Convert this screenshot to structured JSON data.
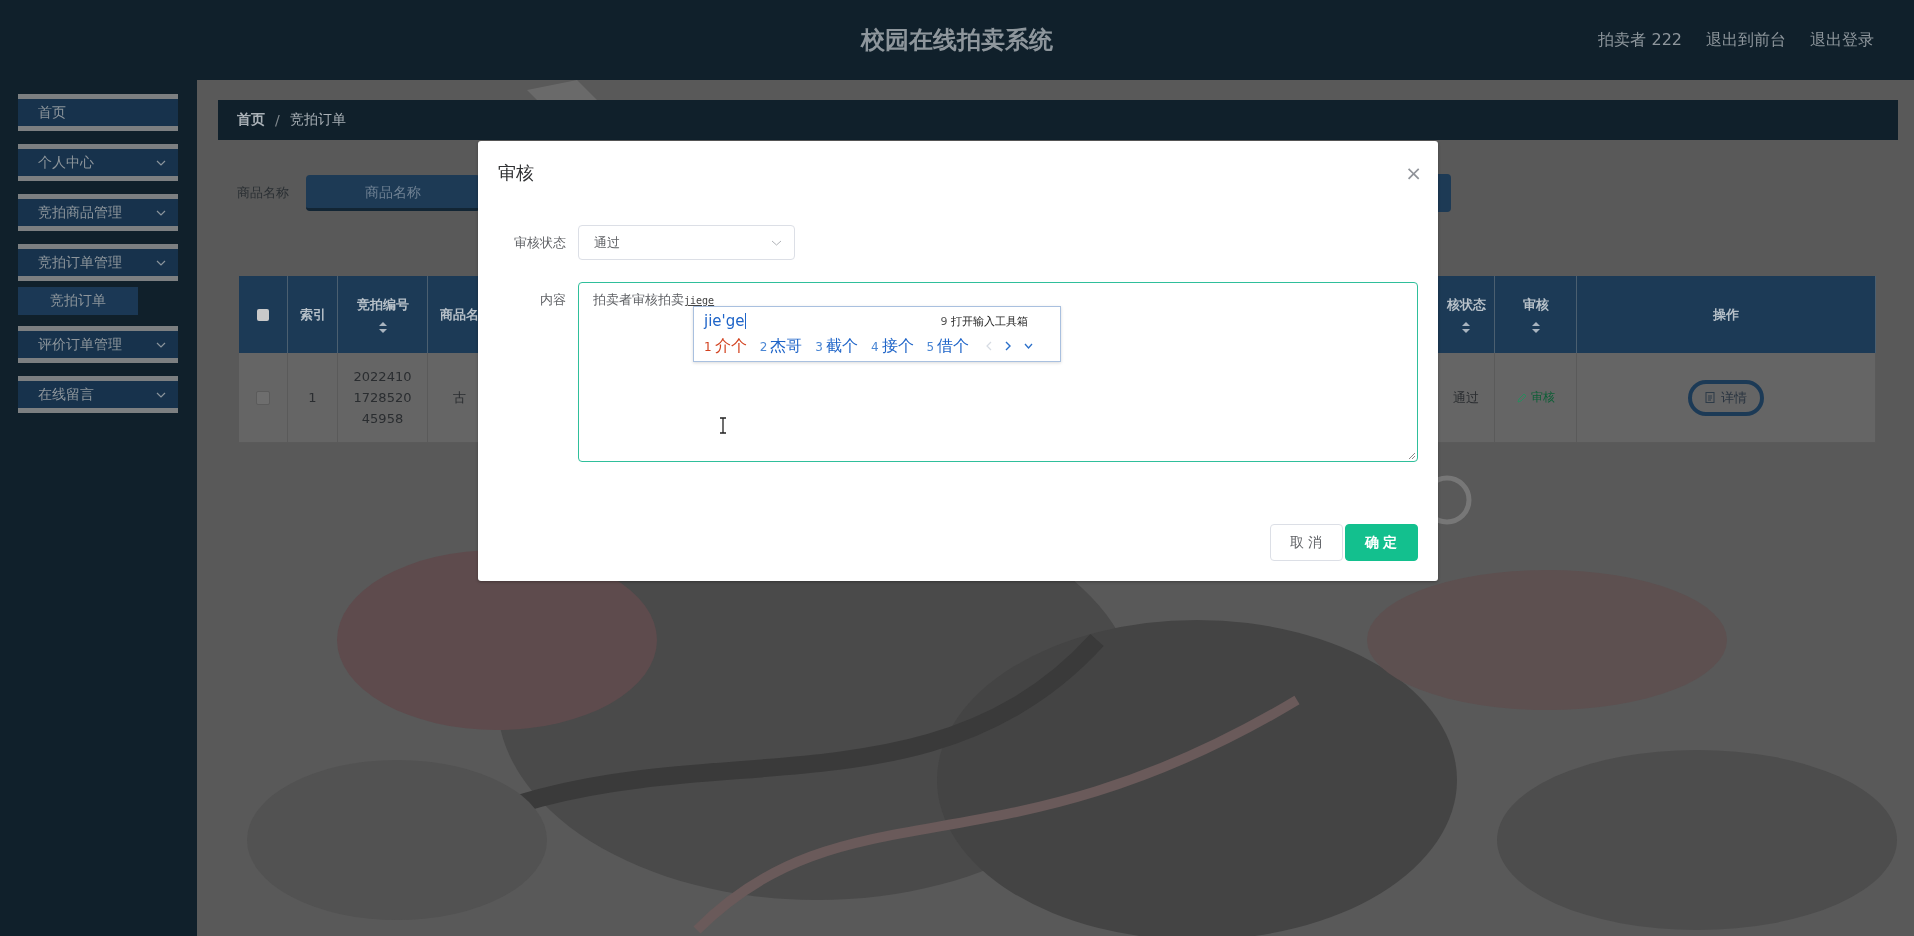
{
  "header": {
    "title": "校园在线拍卖系统",
    "user": "拍卖者 222",
    "links": [
      "退出到前台",
      "退出登录"
    ]
  },
  "sidebar": {
    "items": [
      {
        "label": "首页",
        "kind": "link",
        "selected": false
      },
      {
        "label": "个人中心",
        "kind": "submenu",
        "selected": false
      },
      {
        "label": "竞拍商品管理",
        "kind": "submenu",
        "selected": false
      },
      {
        "label": "竞拍订单管理",
        "kind": "submenu",
        "selected": false,
        "children": [
          {
            "label": "竞拍订单",
            "selected": true
          }
        ]
      },
      {
        "label": "评价订单管理",
        "kind": "submenu",
        "selected": false
      },
      {
        "label": "在线留言",
        "kind": "submenu",
        "selected": false
      }
    ]
  },
  "breadcrumb": {
    "items": [
      "首页",
      "竞拍订单"
    ],
    "separator": "/"
  },
  "search": {
    "label": "商品名称",
    "placeholder": "商品名称"
  },
  "table": {
    "header_checked": false,
    "columns": [
      {
        "label": "索引",
        "sortable": false
      },
      {
        "label": "竞拍编号",
        "sortable": true
      },
      {
        "label": "商品名",
        "sortable": false
      },
      {
        "label": "核状态",
        "sortable": true
      },
      {
        "label": "审核",
        "sortable": true
      },
      {
        "label": "操作",
        "sortable": false
      }
    ],
    "rows": [
      {
        "checked": false,
        "index": "1",
        "number": "2022410172852045958",
        "product": "古",
        "status": "通过",
        "review": "审核",
        "action": "详情"
      }
    ]
  },
  "dialog": {
    "title": "审核",
    "close": "×",
    "status_label": "审核状态",
    "status_value": "通过",
    "content_label": "内容",
    "content_value": "拍卖者审核拍卖",
    "composition": "jiege",
    "buttons": [
      {
        "label": "取消",
        "kind": "secondary"
      },
      {
        "label": "确定",
        "kind": "primary"
      }
    ]
  },
  "ime": {
    "input": "jie'ge",
    "tool_number": "9",
    "tool_label": "打开输入工具箱",
    "prev_disabled": true,
    "candidates": [
      {
        "number": "1",
        "text": "介个",
        "selected": true
      },
      {
        "number": "2",
        "text": "杰哥",
        "selected": false
      },
      {
        "number": "3",
        "text": "截个",
        "selected": false
      },
      {
        "number": "4",
        "text": "接个",
        "selected": false
      },
      {
        "number": "5",
        "text": "借个",
        "selected": false
      }
    ]
  }
}
